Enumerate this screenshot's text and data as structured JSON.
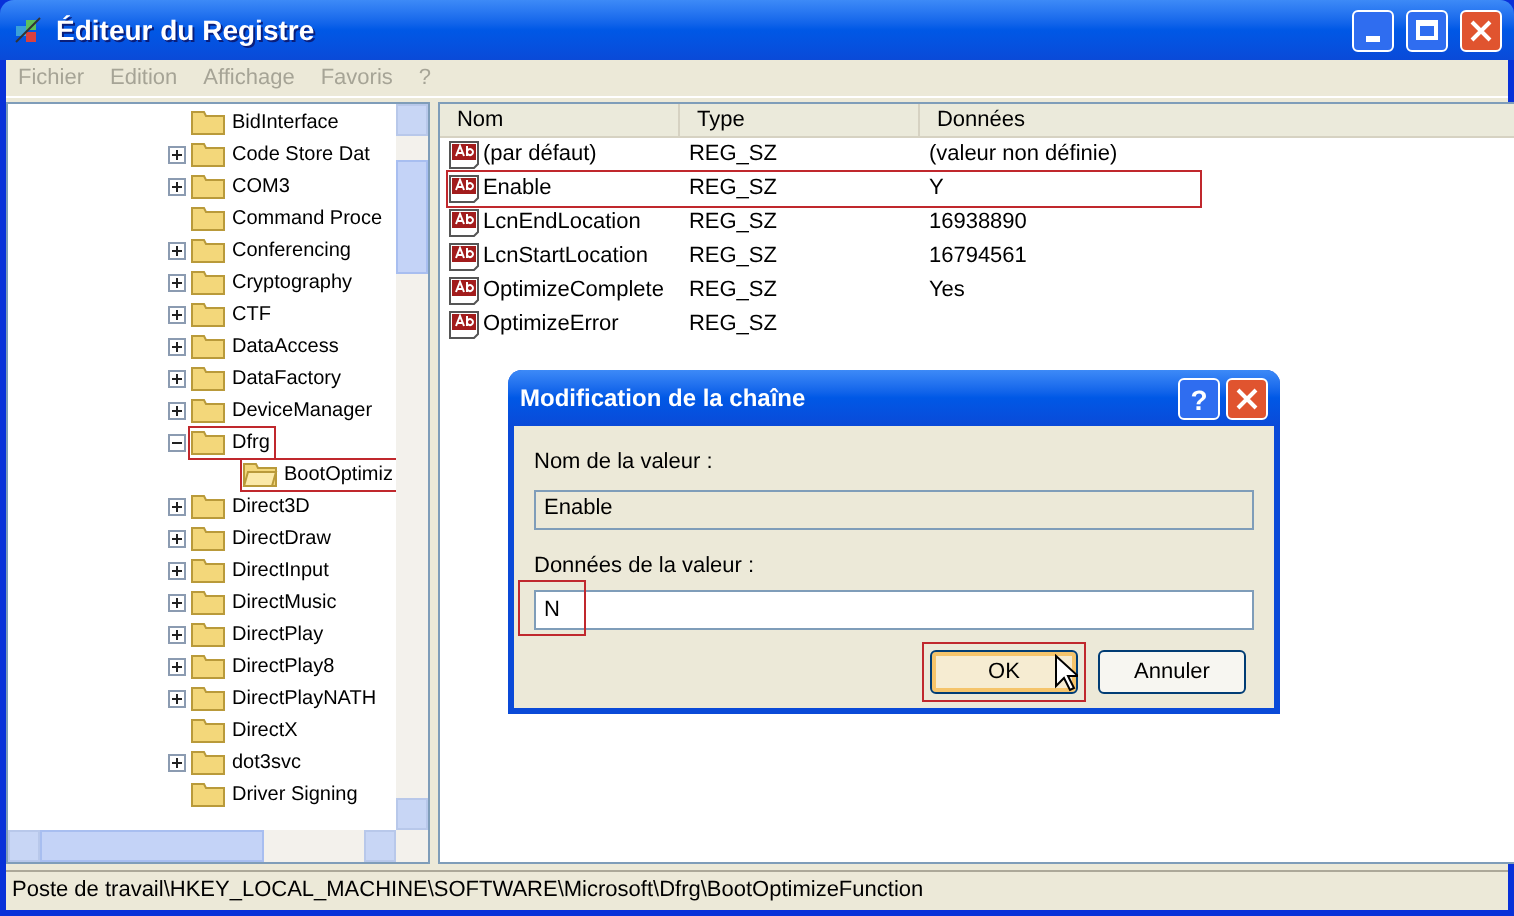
{
  "window": {
    "title": "Éditeur du Registre"
  },
  "menu": [
    "Fichier",
    "Edition",
    "Affichage",
    "Favoris",
    "?"
  ],
  "tree": [
    {
      "label": "BidInterface",
      "kind": "leaf",
      "highlighted": false
    },
    {
      "label": "Code Store Dat",
      "kind": "collapsed",
      "highlighted": false
    },
    {
      "label": "COM3",
      "kind": "collapsed",
      "highlighted": false
    },
    {
      "label": "Command Proce",
      "kind": "leaf",
      "highlighted": false
    },
    {
      "label": "Conferencing",
      "kind": "collapsed",
      "highlighted": false
    },
    {
      "label": "Cryptography",
      "kind": "collapsed",
      "highlighted": false
    },
    {
      "label": "CTF",
      "kind": "collapsed",
      "highlighted": false
    },
    {
      "label": "DataAccess",
      "kind": "collapsed",
      "highlighted": false
    },
    {
      "label": "DataFactory",
      "kind": "collapsed",
      "highlighted": false
    },
    {
      "label": "DeviceManager",
      "kind": "collapsed",
      "highlighted": false
    },
    {
      "label": "Dfrg",
      "kind": "expanded",
      "highlighted": true,
      "children": [
        {
          "label": "BootOptimiz",
          "kind": "leaf",
          "highlighted": true
        }
      ]
    },
    {
      "label": "Direct3D",
      "kind": "collapsed",
      "highlighted": false
    },
    {
      "label": "DirectDraw",
      "kind": "collapsed",
      "highlighted": false
    },
    {
      "label": "DirectInput",
      "kind": "collapsed",
      "highlighted": false
    },
    {
      "label": "DirectMusic",
      "kind": "collapsed",
      "highlighted": false
    },
    {
      "label": "DirectPlay",
      "kind": "collapsed",
      "highlighted": false
    },
    {
      "label": "DirectPlay8",
      "kind": "collapsed",
      "highlighted": false
    },
    {
      "label": "DirectPlayNATH",
      "kind": "collapsed",
      "highlighted": false
    },
    {
      "label": "DirectX",
      "kind": "leaf",
      "highlighted": false
    },
    {
      "label": "dot3svc",
      "kind": "collapsed",
      "highlighted": false
    },
    {
      "label": "Driver Signing",
      "kind": "leaf",
      "highlighted": false
    }
  ],
  "table": {
    "columns": [
      "Nom",
      "Type",
      "Données"
    ],
    "rows": [
      {
        "name": "(par défaut)",
        "type": "REG_SZ",
        "data": "(valeur non définie)",
        "highlighted": false
      },
      {
        "name": "Enable",
        "type": "REG_SZ",
        "data": "Y",
        "highlighted": true
      },
      {
        "name": "LcnEndLocation",
        "type": "REG_SZ",
        "data": "16938890",
        "highlighted": false
      },
      {
        "name": "LcnStartLocation",
        "type": "REG_SZ",
        "data": "16794561",
        "highlighted": false
      },
      {
        "name": "OptimizeComplete",
        "type": "REG_SZ",
        "data": "Yes",
        "highlighted": false
      },
      {
        "name": "OptimizeError",
        "type": "REG_SZ",
        "highlighted": false
      }
    ]
  },
  "dialog": {
    "title": "Modification de la chaîne",
    "help": "?",
    "name_label": "Nom de la valeur :",
    "name_value": "Enable",
    "data_label": "Données de la valeur :",
    "data_value": "N",
    "data_highlighted": true,
    "buttons": [
      {
        "label": "OK",
        "default": true,
        "highlighted": true
      },
      {
        "label": "Annuler",
        "default": false,
        "highlighted": false
      }
    ]
  },
  "status_bar": "Poste de travail\\HKEY_LOCAL_MACHINE\\SOFTWARE\\Microsoft\\Dfrg\\BootOptimizeFunction"
}
